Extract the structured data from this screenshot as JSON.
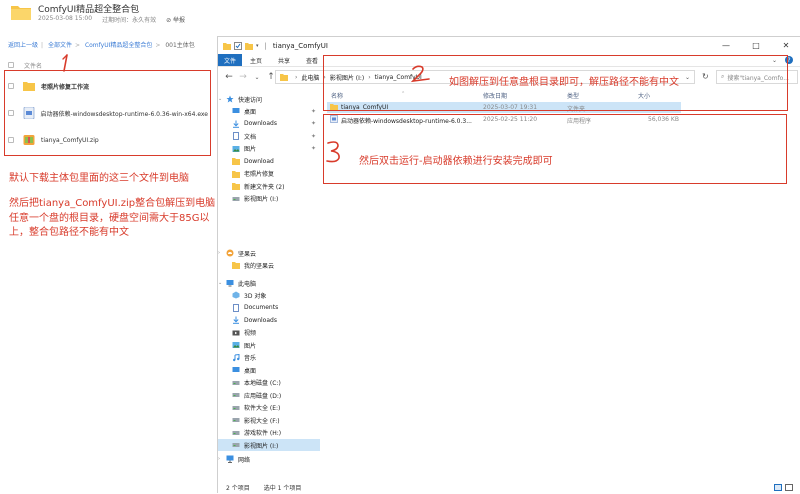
{
  "share": {
    "title": "ComfyUI精品超全整合包",
    "date": "2025-03-08 15:00",
    "expiry": "过期时间：永久有效",
    "report": "举报",
    "breadcrumb": [
      "返回上一级",
      "全部文件",
      "ComfyUI精品超全整合包",
      "001主体包"
    ],
    "column_label": "文件名",
    "files": [
      {
        "name": "老照片修复工作流",
        "icon": "folder-icon"
      },
      {
        "name": "启动器依赖-windowsdesktop-runtime-6.0.36-win-x64.exe",
        "icon": "exe-file-icon"
      },
      {
        "name": "tianya_ComfyUI.zip",
        "icon": "zip-file-icon"
      }
    ]
  },
  "annotations": {
    "n1": "1",
    "n2": "2",
    "n3": "3",
    "note1": "默认下载主体包里面的这三个文件到电脑",
    "note1b": "然后把tianya_ComfyUI.zip整合包解压到电脑任意一个盘的根目录，硬盘空间需大于85G以上，整合包路径不能有中文",
    "note2": "如图解压到任意盘根目录即可，解压路径不能有中文",
    "note3": "然后双击运行-启动器依赖进行安装完成即可",
    "color": "#d83b2b"
  },
  "explorer": {
    "title": "tianya_ComfyUI",
    "ribbon": {
      "file": "文件",
      "tabs": [
        "主页",
        "共享",
        "查看"
      ]
    },
    "window_controls": {
      "min": "—",
      "max": "□",
      "close": "✕"
    },
    "address": [
      "此电脑",
      "影视图片 (I:)",
      "tianya_ComfyUI"
    ],
    "search_placeholder": "搜索\"tianya_Comfo...",
    "columns": {
      "name": "名称",
      "modified": "修改日期",
      "type": "类型",
      "size": "大小"
    },
    "rows": [
      {
        "name": "tianya_ComfyUI",
        "modified": "2025-03-07 19:31",
        "type": "文件夹",
        "size": "",
        "icon": "folder-icon",
        "selected": true
      },
      {
        "name": "启动器依赖-windowsdesktop-runtime-6.0.3...",
        "modified": "2025-02-25 11:20",
        "type": "应用程序",
        "size": "56,036 KB",
        "icon": "installer-icon",
        "selected": false
      }
    ],
    "nav": {
      "quick_access": "快速访问",
      "items": [
        {
          "label": "桌面",
          "icon": "desktop-icon",
          "pinned": true
        },
        {
          "label": "Downloads",
          "icon": "download-icon",
          "pinned": true
        },
        {
          "label": "文档",
          "icon": "document-icon",
          "pinned": true
        },
        {
          "label": "图片",
          "icon": "picture-icon",
          "pinned": true
        },
        {
          "label": "Download",
          "icon": "folder-icon",
          "pinned": false
        },
        {
          "label": "老照片修复",
          "icon": "folder-icon",
          "pinned": false
        },
        {
          "label": "新建文件夹 (2)",
          "icon": "folder-icon",
          "pinned": false
        },
        {
          "label": "影视图片 (I:)",
          "icon": "drive-icon",
          "pinned": false
        }
      ],
      "cloud": "坚果云",
      "cloud_items": [
        {
          "label": "我的坚果云",
          "icon": "folder-icon"
        }
      ],
      "this_pc": "此电脑",
      "pc_items": [
        {
          "label": "3D 对象",
          "icon": "3d-objects-icon"
        },
        {
          "label": "Documents",
          "icon": "document-icon"
        },
        {
          "label": "Downloads",
          "icon": "download-icon"
        },
        {
          "label": "视频",
          "icon": "video-icon"
        },
        {
          "label": "图片",
          "icon": "picture-icon"
        },
        {
          "label": "音乐",
          "icon": "music-icon"
        },
        {
          "label": "桌面",
          "icon": "desktop-icon"
        },
        {
          "label": "本地磁盘 (C:)",
          "icon": "drive-icon"
        },
        {
          "label": "应用磁盘 (D:)",
          "icon": "drive-icon"
        },
        {
          "label": "软件大全 (E:)",
          "icon": "drive-icon"
        },
        {
          "label": "影视大全 (F:)",
          "icon": "drive-icon"
        },
        {
          "label": "游戏软件 (H:)",
          "icon": "drive-icon"
        },
        {
          "label": "影视图片 (I:)",
          "icon": "drive-icon",
          "selected": true
        }
      ],
      "network": "网络"
    },
    "status": {
      "count": "2 个项目",
      "selected": "选中 1 个项目"
    }
  }
}
